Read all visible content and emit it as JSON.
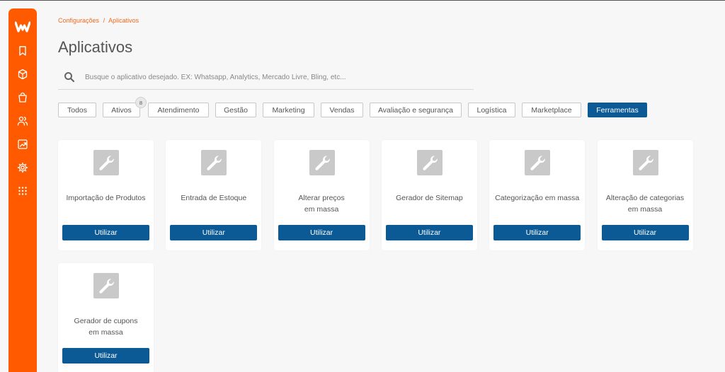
{
  "breadcrumb": {
    "parent": "Configurações",
    "separator": "/",
    "current": "Aplicativos"
  },
  "page": {
    "title": "Aplicativos"
  },
  "search": {
    "placeholder": "Busque o aplicativo desejado. EX: Whatsapp, Analytics, Mercado Livre, Bling, etc...",
    "icon": "search-icon"
  },
  "sidebar": {
    "brand_color": "#ff5a00",
    "logo": "w-logo",
    "items": [
      {
        "icon": "bookmark-icon"
      },
      {
        "icon": "box-icon"
      },
      {
        "icon": "shopping-bag-icon"
      },
      {
        "icon": "users-icon"
      },
      {
        "icon": "chart-icon"
      },
      {
        "icon": "gear-icon"
      },
      {
        "icon": "grid-icon"
      }
    ]
  },
  "filters": [
    {
      "label": "Todos",
      "active": false
    },
    {
      "label": "Ativos",
      "active": false,
      "badge": "8"
    },
    {
      "label": "Atendimento",
      "active": false
    },
    {
      "label": "Gestão",
      "active": false
    },
    {
      "label": "Marketing",
      "active": false
    },
    {
      "label": "Vendas",
      "active": false
    },
    {
      "label": "Avaliação e segurança",
      "active": false
    },
    {
      "label": "Logística",
      "active": false
    },
    {
      "label": "Marketplace",
      "active": false
    },
    {
      "label": "Ferramentas",
      "active": true
    }
  ],
  "apps": [
    {
      "name": "Importação de Produtos",
      "button": "Utilizar",
      "icon": "wrench-icon"
    },
    {
      "name": "Entrada de Estoque",
      "button": "Utilizar",
      "icon": "wrench-icon"
    },
    {
      "name": "Alterar preços\nem massa",
      "button": "Utilizar",
      "icon": "wrench-icon"
    },
    {
      "name": "Gerador de Sitemap",
      "button": "Utilizar",
      "icon": "wrench-icon"
    },
    {
      "name": "Categorização em massa",
      "button": "Utilizar",
      "icon": "wrench-icon"
    },
    {
      "name": "Alteração de categorias\nem massa",
      "button": "Utilizar",
      "icon": "wrench-icon"
    },
    {
      "name": "Gerador de cupons\nem massa",
      "button": "Utilizar",
      "icon": "wrench-icon"
    }
  ],
  "colors": {
    "accent": "#ff5a00",
    "primary_button": "#0b5a96",
    "link": "#f06a1e"
  }
}
